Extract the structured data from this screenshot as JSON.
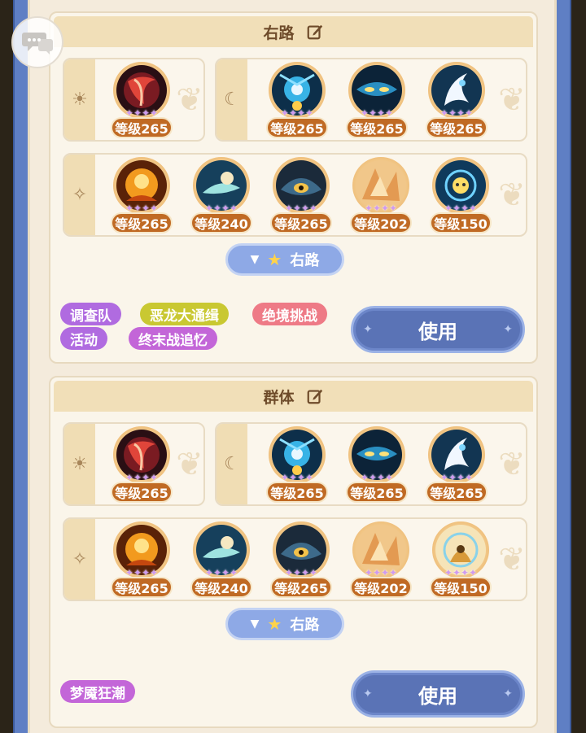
{
  "colors": {
    "frame_blue": "#5f7fc4",
    "panel_cream": "#faf5ea",
    "level_badge": "#c06a24",
    "route_button": "#8ea9e6",
    "use_button": "#5a73b6"
  },
  "icons": {
    "chat": "chat-bubble-icon",
    "edit": "edit-icon",
    "sun": "sun-icon",
    "moon": "moon-icon",
    "sparkle": "sparkle-icon",
    "star": "star-icon",
    "dropdown": "triangle-down-icon"
  },
  "teams": [
    {
      "name": "右路",
      "sun_slots": [
        {
          "level": "等级265"
        }
      ],
      "moon_slots": [
        {
          "level": "等级265"
        },
        {
          "level": "等级265"
        },
        {
          "level": "等级265"
        }
      ],
      "star_slots": [
        {
          "level": "等级265"
        },
        {
          "level": "等级240"
        },
        {
          "level": "等级265"
        },
        {
          "level": "等级202"
        },
        {
          "level": "等级150"
        }
      ],
      "route_label": "右路",
      "tags": [
        {
          "text": "调查队",
          "color": "#b06be0"
        },
        {
          "text": "恶龙大通缉",
          "color": "#c9c832"
        },
        {
          "text": "绝境挑战",
          "color": "#ee7a86"
        },
        {
          "text": "活动",
          "color": "#b06be0"
        },
        {
          "text": "终末战追忆",
          "color": "#c366d8"
        }
      ],
      "use_label": "使用"
    },
    {
      "name": "群体",
      "sun_slots": [
        {
          "level": "等级265"
        }
      ],
      "moon_slots": [
        {
          "level": "等级265"
        },
        {
          "level": "等级265"
        },
        {
          "level": "等级265"
        }
      ],
      "star_slots": [
        {
          "level": "等级265"
        },
        {
          "level": "等级240"
        },
        {
          "level": "等级265"
        },
        {
          "level": "等级202"
        },
        {
          "level": "等级150"
        }
      ],
      "route_label": "右路",
      "tags": [
        {
          "text": "梦魇狂潮",
          "color": "#c366d8"
        }
      ],
      "use_label": "使用"
    }
  ]
}
